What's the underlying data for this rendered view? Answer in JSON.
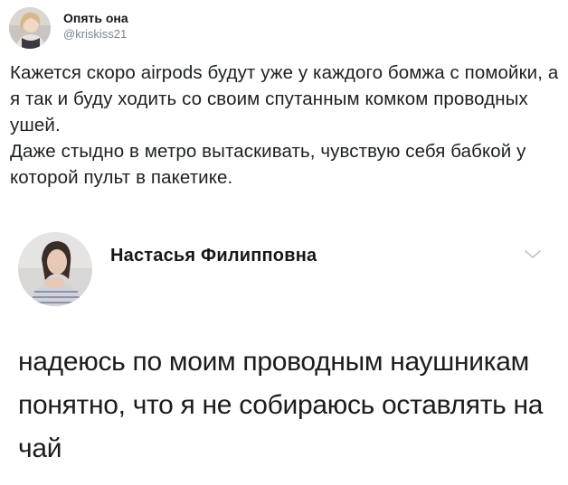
{
  "tweet": {
    "author_name": "Опять она",
    "author_handle": "@kriskiss21",
    "avatar_icon": "user-photo-avatar",
    "text": "Кажется скоро airpods будут уже у каждого бомжа с помойки, а я так и буду ходить со своим спутанным комком проводных ушей.\nДаже стыдно в метро вытаскивать, чувствую себя бабкой у которой пульт в пакетике."
  },
  "reply": {
    "author_name": "Настасья Филипповна",
    "avatar_icon": "user-photo-avatar",
    "menu_icon": "chevron-down-icon",
    "text": "надеюсь по моим проводным наушникам понятно, что я не собираюсь оставлять на чай"
  },
  "colors": {
    "text_primary": "#1c2022",
    "text_secondary": "#7a8690",
    "chevron": "#b8c2cc",
    "background": "#ffffff"
  }
}
